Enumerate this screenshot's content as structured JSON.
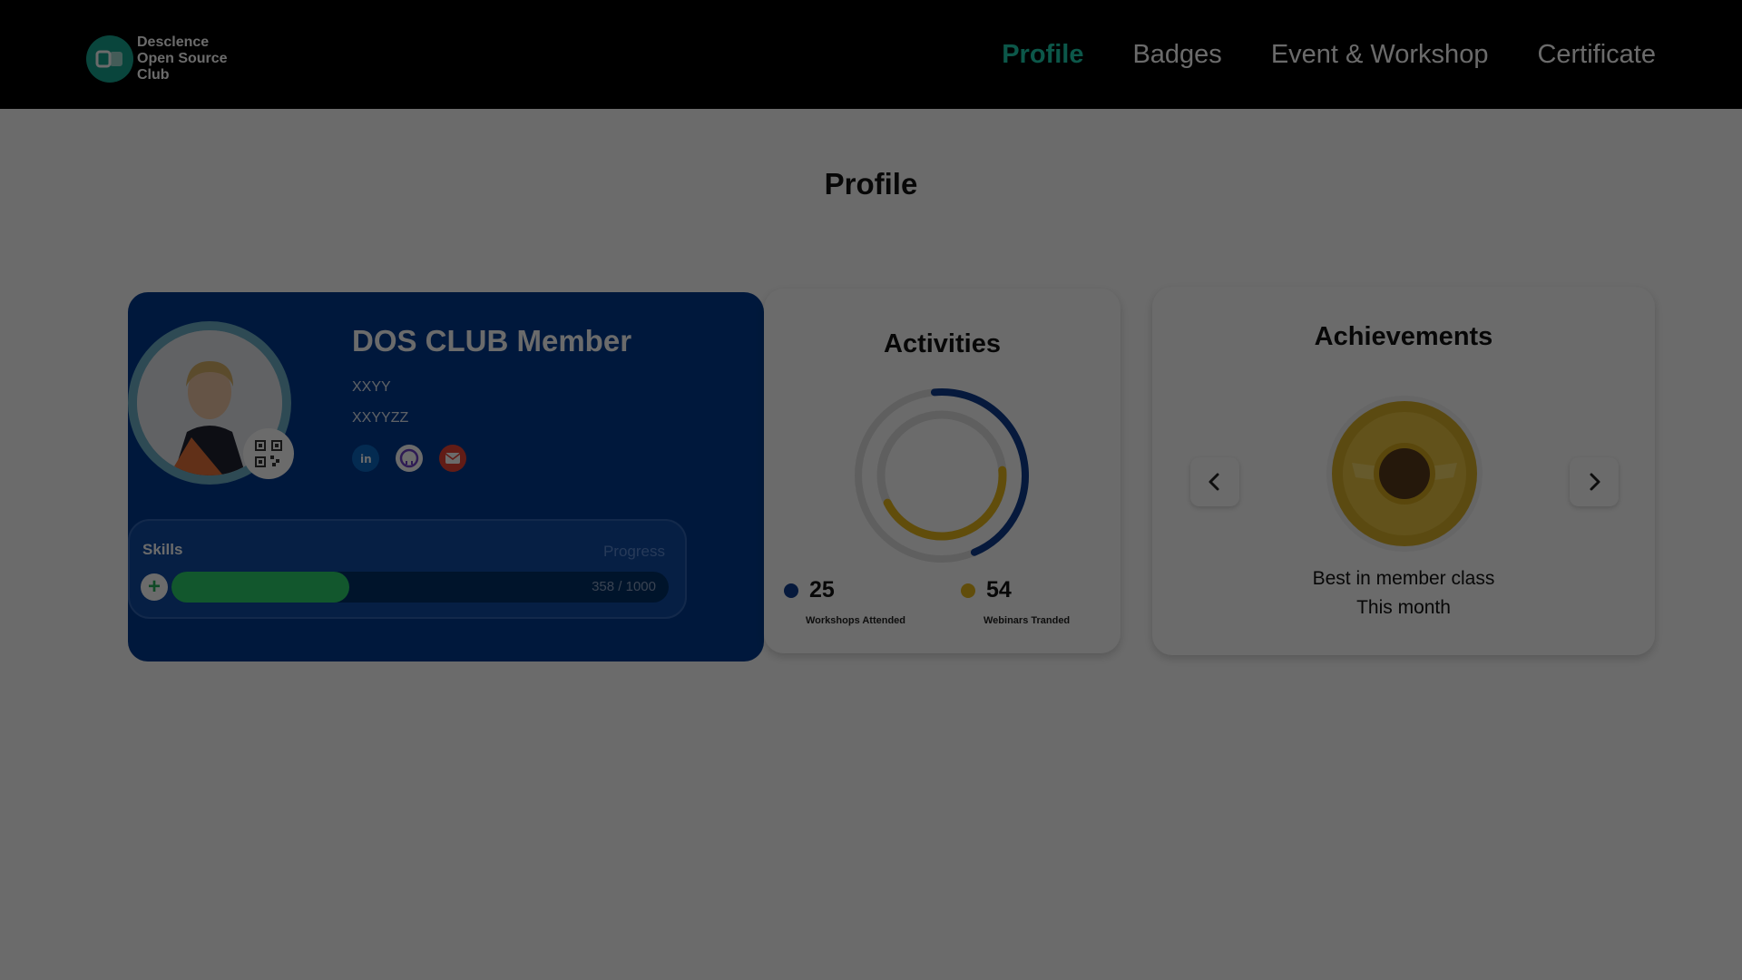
{
  "brand": {
    "line1": "Desclence",
    "line2": "Open Source",
    "line3": "Club",
    "logo_icon": "dos-logo-icon",
    "accent_color": "#1ecfae"
  },
  "nav": {
    "items": [
      {
        "label": "Profile",
        "active": true
      },
      {
        "label": "Badges",
        "active": false
      },
      {
        "label": "Event & Workshop",
        "active": false
      },
      {
        "label": "Certificate",
        "active": false
      }
    ]
  },
  "page": {
    "title": "Profile"
  },
  "member": {
    "title": "DOS CLUB Member",
    "line1": "XXYY",
    "line2": "XXYYZZ",
    "socials": [
      "linkedin-icon",
      "github-icon",
      "email-icon"
    ],
    "card_color": "#003b8f"
  },
  "skills": {
    "label": "Skills",
    "progress_label": "Progress",
    "current": 358,
    "total": 1000,
    "text": "358 / 1000",
    "bar_color": "#2bd06b"
  },
  "activities": {
    "title": "Activities",
    "workshops": {
      "value": "25",
      "caption": "Workshops Attended",
      "color": "#0f3d8f"
    },
    "webinars": {
      "value": "54",
      "caption": "Webinars Tranded",
      "color": "#e8b81c"
    }
  },
  "achievements": {
    "title": "Achievements",
    "line1": "Best in member class",
    "line2": "This month",
    "prev_icon": "chevron-left-icon",
    "next_icon": "chevron-right-icon",
    "medal_icon": "gold-medal-icon"
  }
}
